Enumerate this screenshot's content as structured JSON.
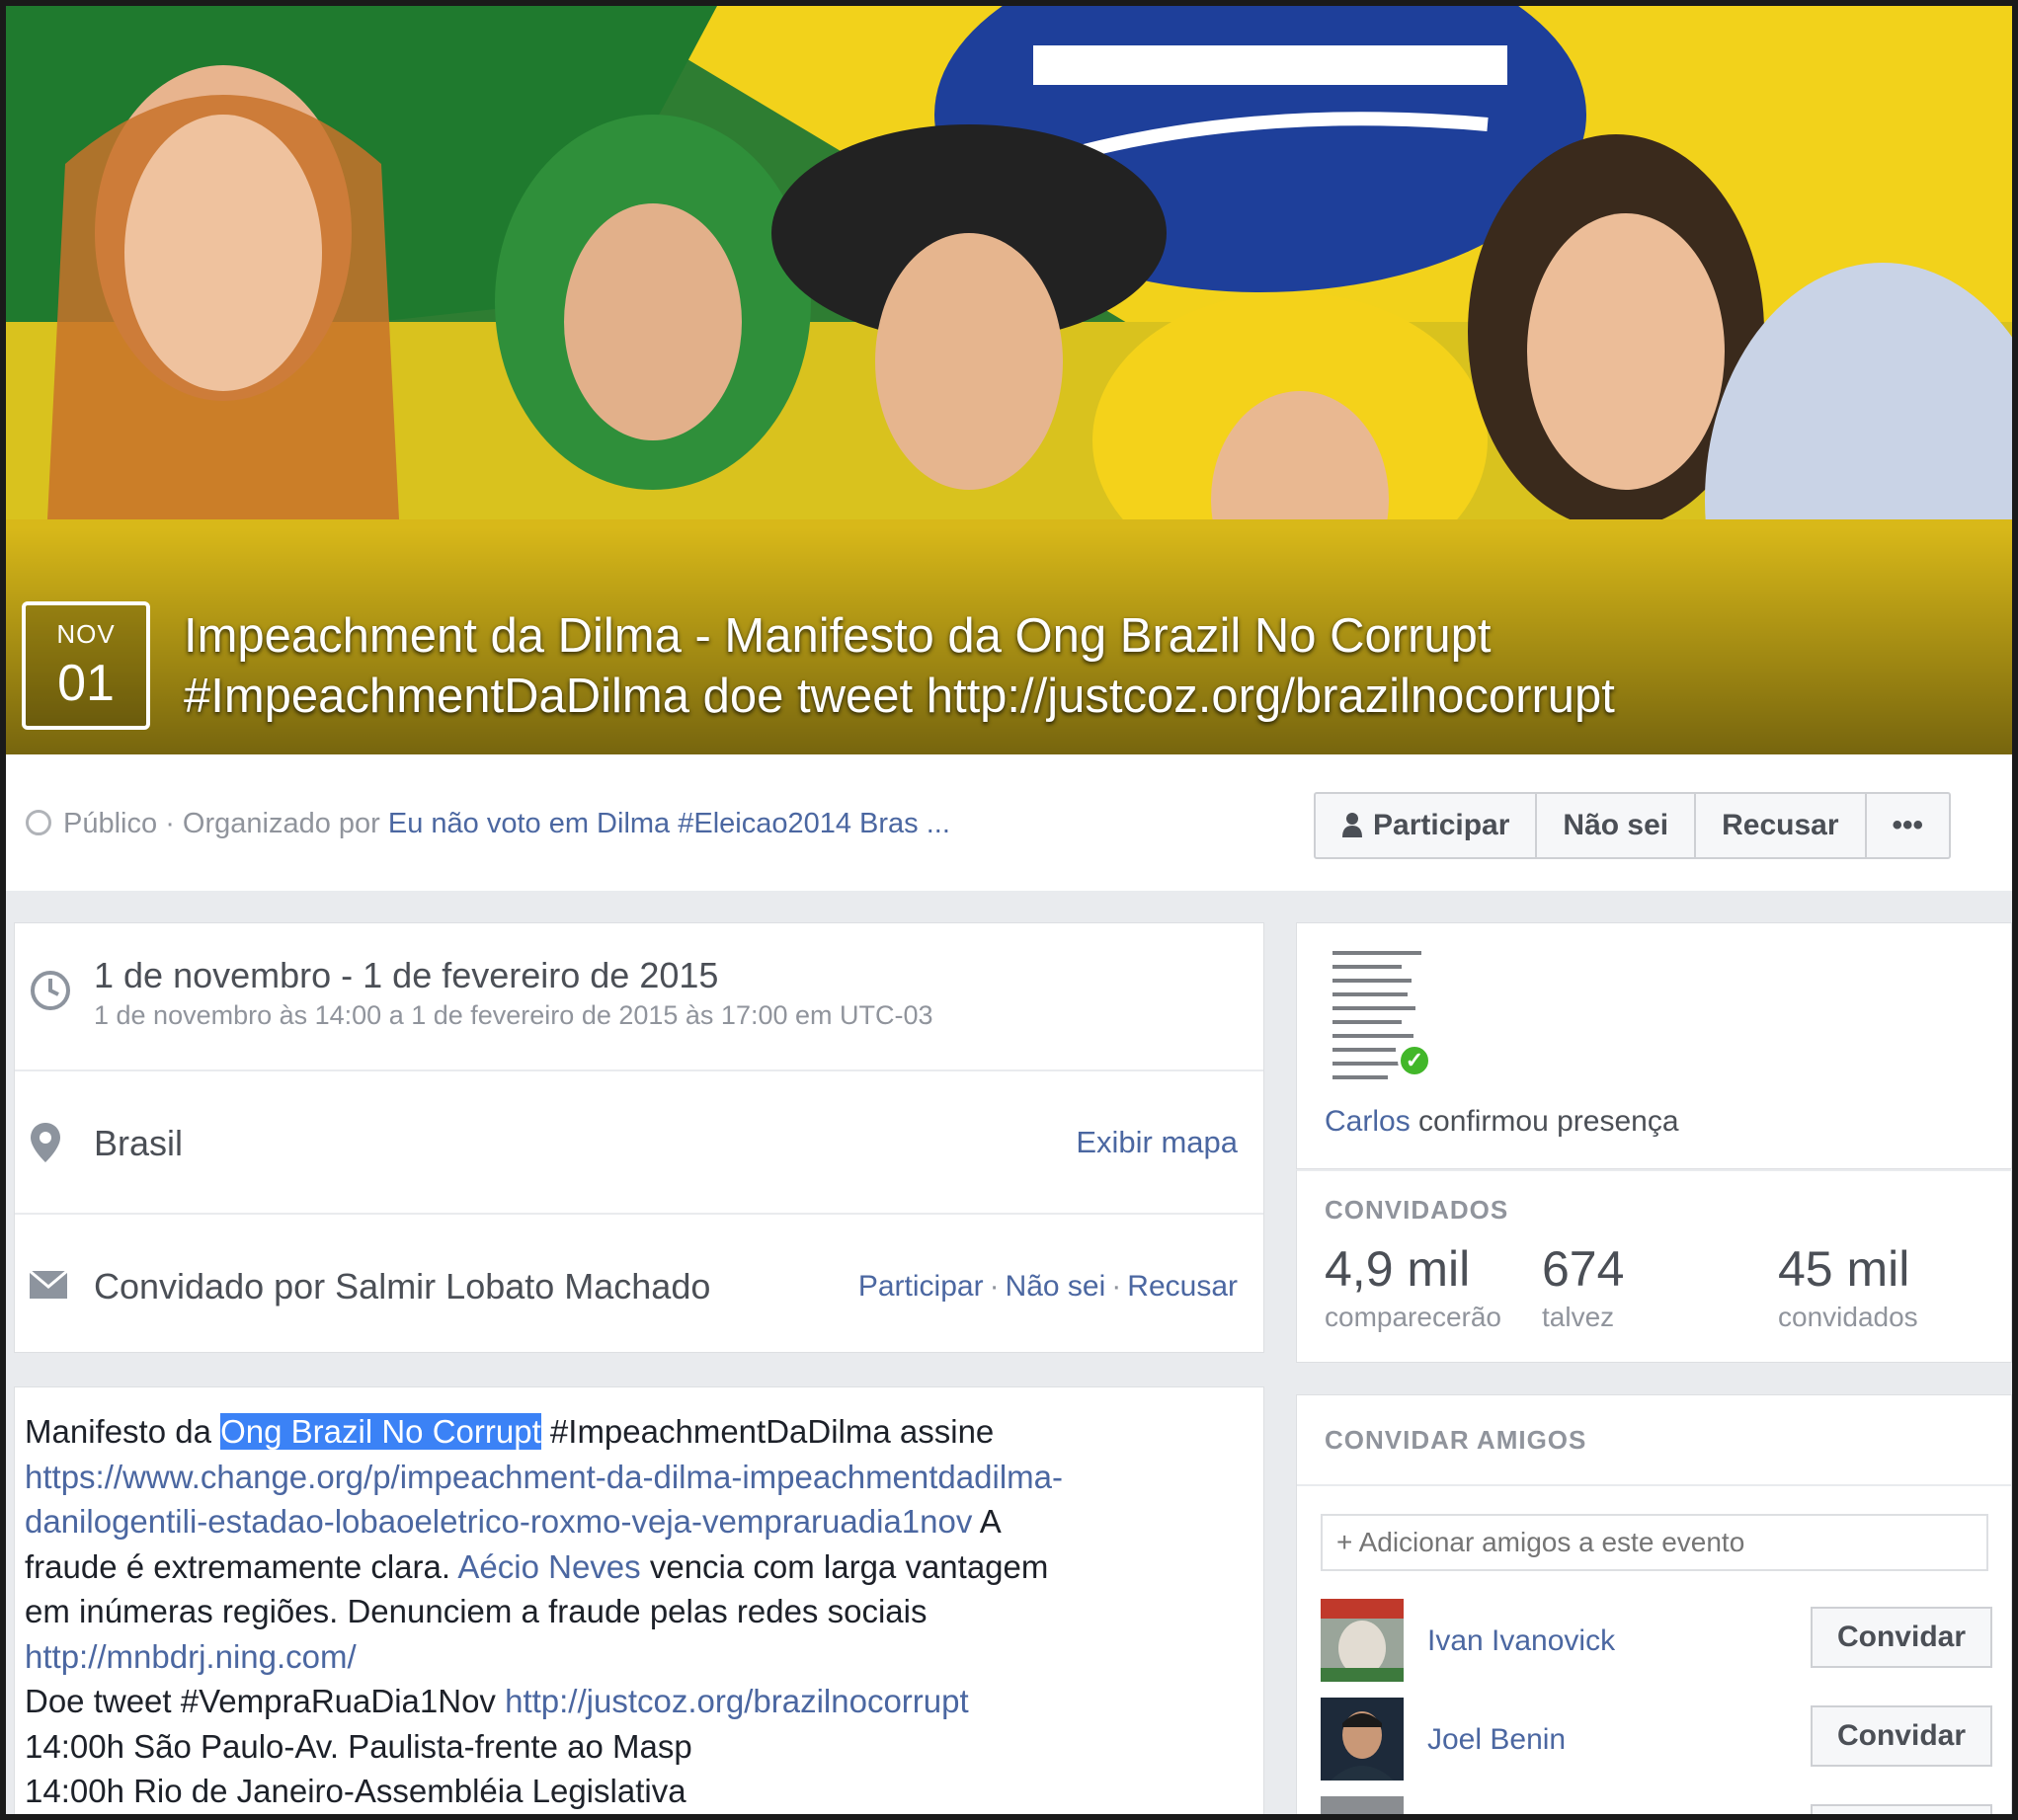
{
  "cover": {
    "image_alt": "",
    "date_month": "NOV",
    "date_day": "01",
    "title_line1": "Impeachment da Dilma - Manifesto da Ong Brazil No Corrupt",
    "title_line2": "#ImpeachmentDaDilma doe tweet http://justcoz.org/brazilnocorrupt"
  },
  "meta": {
    "privacy": "Público",
    "organized_by_label": "· Organizado por",
    "organizer": "Eu não voto em Dilma #Eleicao2014 Bras ..."
  },
  "rsvp": {
    "join": "Participar",
    "maybe": "Não sei",
    "decline": "Recusar",
    "more": "•••"
  },
  "details": {
    "date_main": "1 de novembro - 1 de fevereiro de 2015",
    "date_sub": "1 de novembro às 14:00 a 1 de fevereiro de 2015 às 17:00 em UTC-03",
    "location": "Brasil",
    "show_map": "Exibir mapa",
    "invited_by": "Convidado por Salmir Lobato Machado",
    "inv_join": "Participar",
    "inv_maybe": "Não sei",
    "inv_decline": "Recusar",
    "sep": "·"
  },
  "description": {
    "l1_a": "Manifesto da ",
    "l1_hl": "Ong Brazil No Corrupt",
    "l1_b": " #ImpeachmentDaDilma assine",
    "l2_link": "https://www.change.org/p/impeachment-da-dilma-impeachmentdadilma-",
    "l3_link": "danilogentili-estadao-lobaoeletrico-roxmo-veja-vempraruadia1nov",
    "l3_b": " A",
    "l4_a": "fraude é extremamente clara. ",
    "l4_link": "Aécio Neves",
    "l4_b": " vencia com larga vantagem",
    "l5": "em inúmeras regiões. Denunciem a fraude pelas redes sociais",
    "l6_link": "http://mnbdrj.ning.com/",
    "l7_a": "Doe tweet #VempraRuaDia1Nov ",
    "l7_link": "http://justcoz.org/brazilnocorrupt",
    "l8": "14:00h São Paulo-Av. Paulista-frente ao Masp",
    "l9": "14:00h Rio de Janeiro-Assembléia Legislativa"
  },
  "confirm": {
    "name": "Carlos",
    "text": " confirmou presença"
  },
  "stats": {
    "heading": "CONVIDADOS",
    "going_num": "4,9 mil",
    "going_lbl": "comparecerão",
    "maybe_num": "674",
    "maybe_lbl": "talvez",
    "invited_num": "45 mil",
    "invited_lbl": "convidados"
  },
  "invite": {
    "heading": "CONVIDAR AMIGOS",
    "placeholder": "+ Adicionar amigos a este evento",
    "button": "Convidar",
    "friends": [
      {
        "name": "Ivan Ivanovick"
      },
      {
        "name": "Joel Benin"
      },
      {
        "name": ""
      }
    ]
  },
  "colors": {
    "link": "#4b67a1",
    "accent_green": "#42b72a",
    "flag_green": "#1f7a2e",
    "flag_yellow": "#f2d21b",
    "flag_blue": "#1e3f9a",
    "selection": "#3b82f6"
  },
  "icons": {
    "privacy": "globe-icon",
    "date": "clock-icon",
    "location": "map-pin-icon",
    "invite": "envelope-icon",
    "join": "person-icon",
    "confirm": "check-icon"
  }
}
